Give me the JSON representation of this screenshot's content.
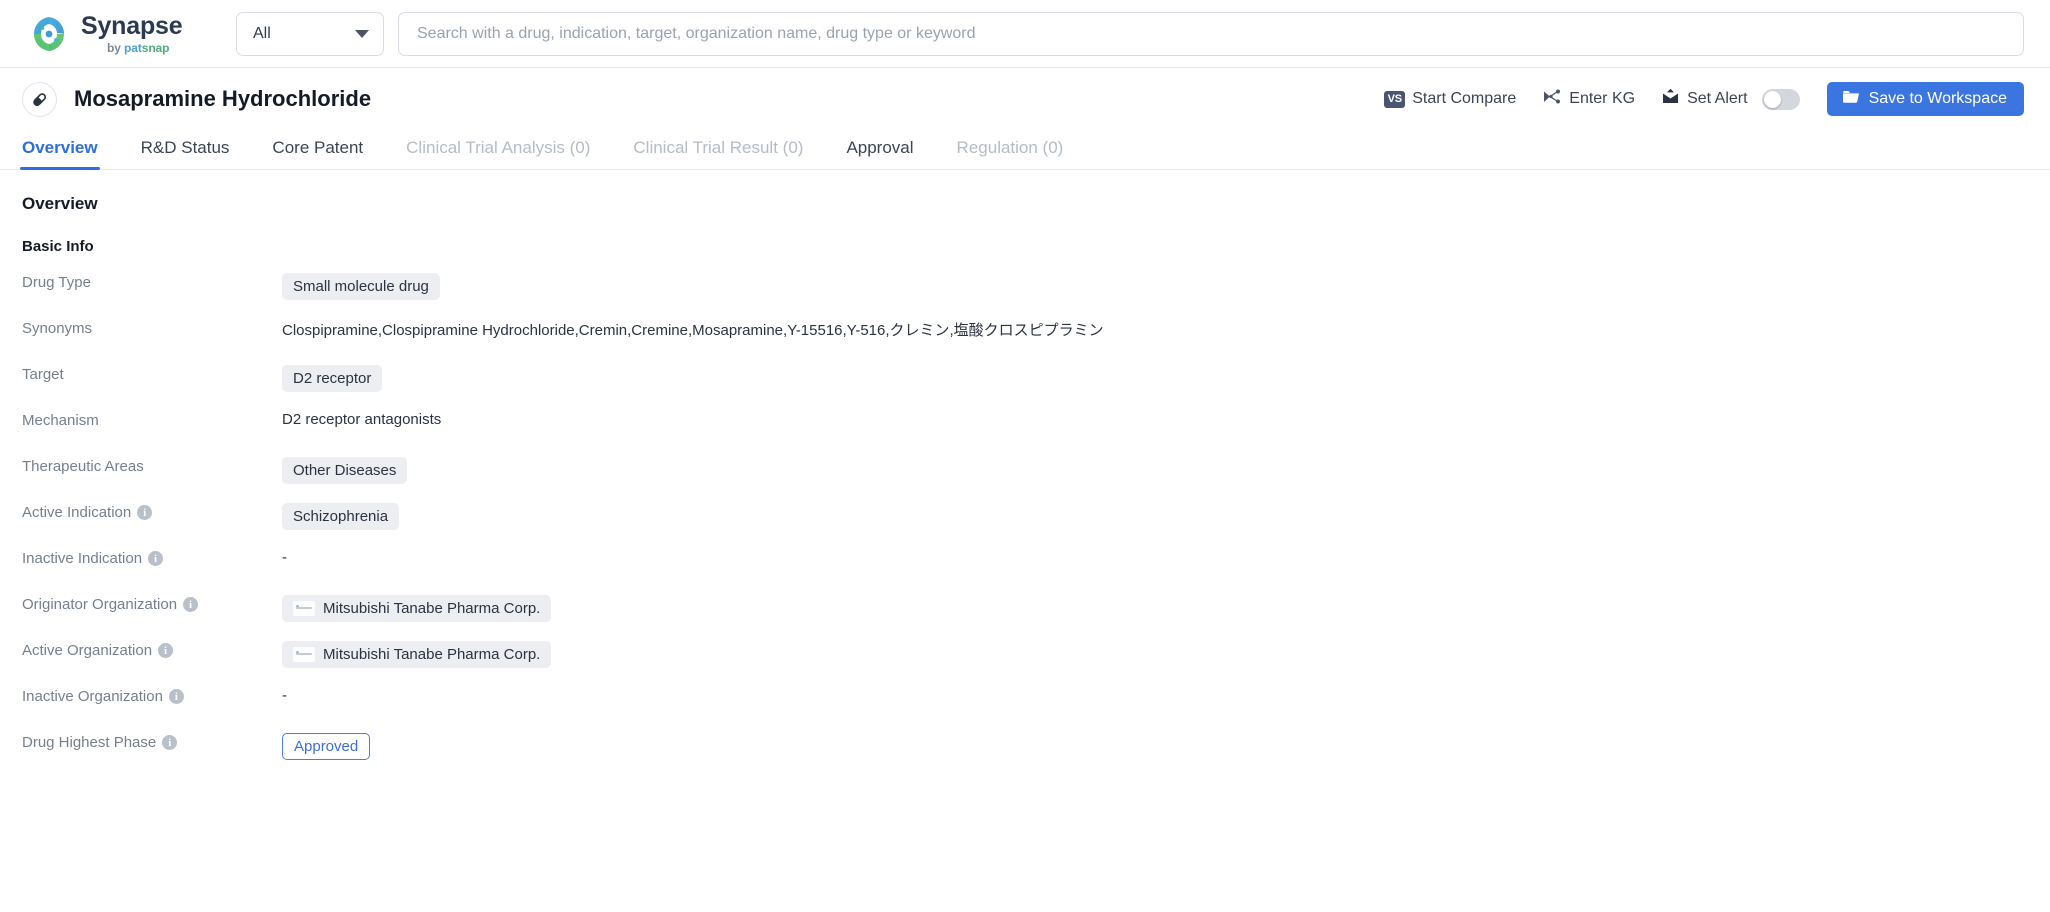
{
  "topbar": {
    "logo": {
      "title": "Synapse",
      "by": "by",
      "pat": "pat",
      "snap": "snap",
      "icon": "synapse-swirl-logo"
    },
    "scope_select": {
      "value": "All",
      "caret_icon": "chevron-down-icon"
    },
    "search": {
      "placeholder": "Search with a drug, indication, target, organization name, drug type or keyword",
      "value": ""
    }
  },
  "header": {
    "drug_icon": "capsule-pill-icon",
    "title": "Mosapramine Hydrochloride",
    "actions": {
      "start_compare": {
        "label": "Start Compare",
        "icon": "vs-icon",
        "icon_text": "VS"
      },
      "enter_kg": {
        "label": "Enter KG",
        "icon": "knowledge-graph-icon"
      },
      "set_alert": {
        "label": "Set Alert",
        "icon": "alert-bell-icon",
        "toggle_state": "off"
      },
      "save_workspace": {
        "label": "Save to Workspace",
        "icon": "folder-icon"
      }
    }
  },
  "tabs": [
    {
      "label": "Overview",
      "state": "active"
    },
    {
      "label": "R&D Status",
      "state": "default"
    },
    {
      "label": "Core Patent",
      "state": "default"
    },
    {
      "label": "Clinical Trial Analysis (0)",
      "state": "disabled"
    },
    {
      "label": "Clinical Trial Result (0)",
      "state": "disabled"
    },
    {
      "label": "Approval",
      "state": "default"
    },
    {
      "label": "Regulation (0)",
      "state": "disabled"
    }
  ],
  "content": {
    "section_title": "Overview",
    "subsection_title": "Basic Info",
    "rows": [
      {
        "label": "Drug Type",
        "has_info": false,
        "type": "chip",
        "value": "Small molecule drug"
      },
      {
        "label": "Synonyms",
        "has_info": false,
        "type": "text",
        "value": "Clospipramine,Clospipramine Hydrochloride,Cremin,Cremine,Mosapramine,Y-15516,Y-516,クレミン,塩酸クロスピプラミン"
      },
      {
        "label": "Target",
        "has_info": false,
        "type": "chip",
        "value": "D2 receptor"
      },
      {
        "label": "Mechanism",
        "has_info": false,
        "type": "text",
        "value": "D2 receptor antagonists"
      },
      {
        "label": "Therapeutic Areas",
        "has_info": false,
        "type": "chip",
        "value": "Other Diseases"
      },
      {
        "label": "Active Indication",
        "has_info": true,
        "type": "chip",
        "value": "Schizophrenia"
      },
      {
        "label": "Inactive Indication",
        "has_info": true,
        "type": "dash",
        "value": "-"
      },
      {
        "label": "Originator Organization",
        "has_info": true,
        "type": "org-chip",
        "value": "Mitsubishi Tanabe Pharma Corp."
      },
      {
        "label": "Active Organization",
        "has_info": true,
        "type": "org-chip",
        "value": "Mitsubishi Tanabe Pharma Corp."
      },
      {
        "label": "Inactive Organization",
        "has_info": true,
        "type": "dash",
        "value": "-"
      },
      {
        "label": "Drug Highest Phase",
        "has_info": true,
        "type": "badge-outline",
        "value": "Approved"
      }
    ],
    "info_icon_glyph": "i"
  },
  "colors": {
    "accent_blue": "#2d6fdc",
    "button_blue": "#3b76e0",
    "chip_bg": "#eceef2",
    "label_gray": "#757f8d",
    "disabled_gray": "#b5bcc6"
  }
}
